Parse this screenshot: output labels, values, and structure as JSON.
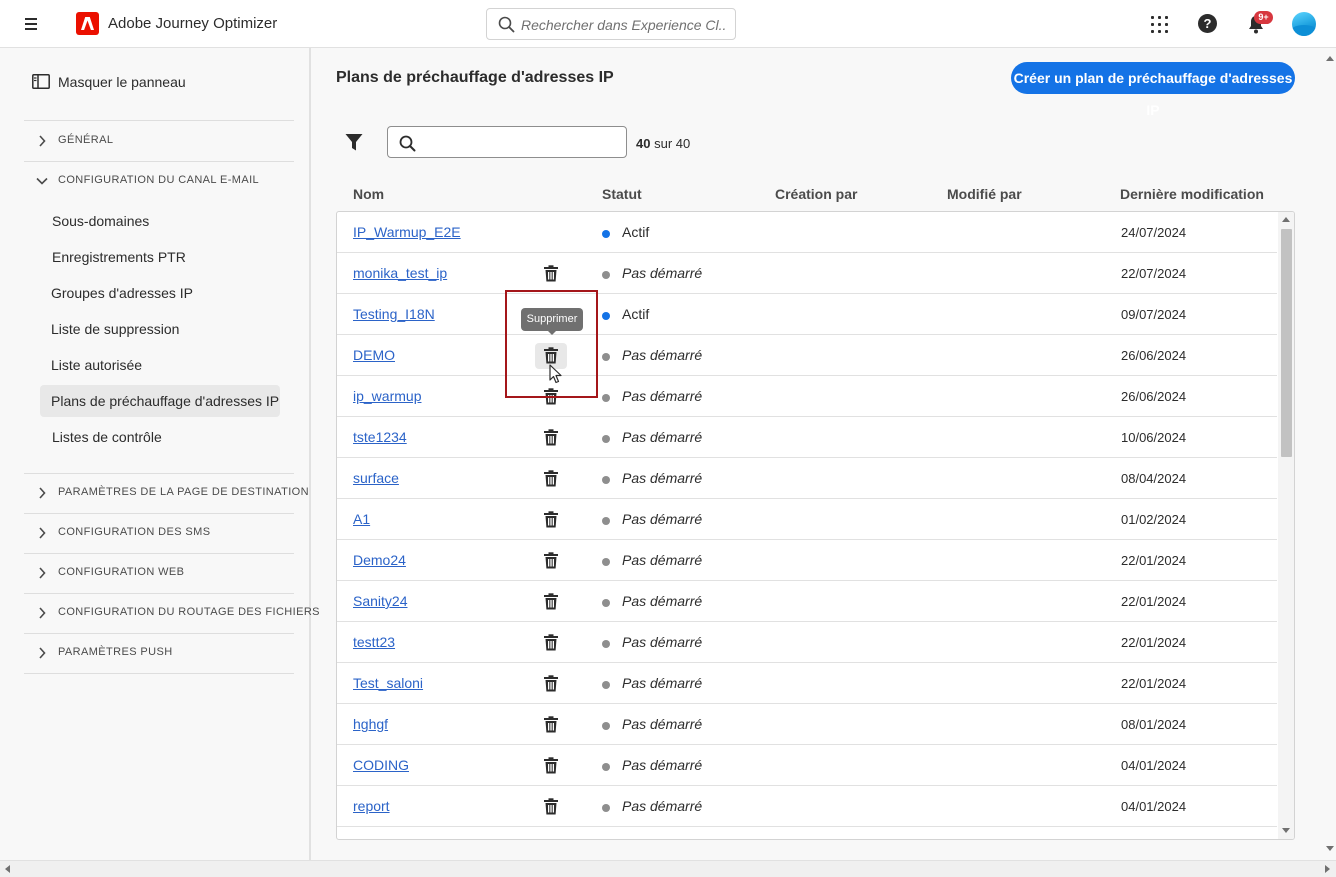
{
  "topbar": {
    "app_title": "Adobe Journey Optimizer",
    "search_placeholder": "Rechercher dans Experience Cl...",
    "notification_badge": "9+",
    "icons": [
      "menu-icon",
      "adobe-logo-icon",
      "search-icon",
      "apps-grid-icon",
      "help-icon",
      "bell-icon",
      "avatar"
    ]
  },
  "sidebar": {
    "hide_panel_label": "Masquer le panneau",
    "sections": [
      {
        "label": "GÉNÉRAL",
        "expanded": false
      },
      {
        "label": "CONFIGURATION DU CANAL E-MAIL",
        "expanded": true
      },
      {
        "label": "PARAMÈTRES DE LA PAGE DE DESTINATION",
        "expanded": false
      },
      {
        "label": "CONFIGURATION DES SMS",
        "expanded": false
      },
      {
        "label": "CONFIGURATION WEB",
        "expanded": false
      },
      {
        "label": "CONFIGURATION DU ROUTAGE DES FICHIERS",
        "expanded": false
      },
      {
        "label": "PARAMÈTRES PUSH",
        "expanded": false
      }
    ],
    "email_items": [
      {
        "label": "Sous-domaines",
        "active": false
      },
      {
        "label": "Enregistrements PTR",
        "active": false
      },
      {
        "label": "Groupes d'adresses IP",
        "active": false
      },
      {
        "label": "Liste de suppression",
        "active": false
      },
      {
        "label": "Liste autorisée",
        "active": false
      },
      {
        "label": "Plans de préchauffage d'adresses IP",
        "active": true
      },
      {
        "label": "Listes de contrôle",
        "active": false
      }
    ]
  },
  "main": {
    "title": "Plans de préchauffage d'adresses IP",
    "create_button": "Créer un plan de préchauffage d'adresses IP",
    "search_value": "",
    "count_shown": "40",
    "count_total": "sur 40",
    "columns": [
      "Nom",
      "Statut",
      "Création par",
      "Modifié par",
      "Dernière modification"
    ],
    "tooltip": "Supprimer",
    "status_colors": {
      "active": "#1473e6",
      "not_started": "#8e8e8e"
    },
    "rows": [
      {
        "name": "IP_Warmup_E2E",
        "status": "Actif",
        "state": "active",
        "created_by": "",
        "modified_by": "",
        "date": "24/07/2024",
        "delete": false
      },
      {
        "name": "monika_test_ip",
        "status": "Pas démarré",
        "state": "not_started",
        "created_by": "",
        "modified_by": "",
        "date": "22/07/2024",
        "delete": true
      },
      {
        "name": "Testing_I18N",
        "status": "Actif",
        "state": "active",
        "created_by": "",
        "modified_by": "",
        "date": "09/07/2024",
        "delete": false
      },
      {
        "name": "DEMO",
        "status": "Pas démarré",
        "state": "not_started",
        "created_by": "",
        "modified_by": "",
        "date": "26/06/2024",
        "delete": true,
        "hovered": true
      },
      {
        "name": "ip_warmup",
        "status": "Pas démarré",
        "state": "not_started",
        "created_by": "",
        "modified_by": "",
        "date": "26/06/2024",
        "delete": true
      },
      {
        "name": "tste1234",
        "status": "Pas démarré",
        "state": "not_started",
        "created_by": "",
        "modified_by": "",
        "date": "10/06/2024",
        "delete": true
      },
      {
        "name": "surface",
        "status": "Pas démarré",
        "state": "not_started",
        "created_by": "",
        "modified_by": "",
        "date": "08/04/2024",
        "delete": true
      },
      {
        "name": "A1",
        "status": "Pas démarré",
        "state": "not_started",
        "created_by": "",
        "modified_by": "",
        "date": "01/02/2024",
        "delete": true
      },
      {
        "name": "Demo24",
        "status": "Pas démarré",
        "state": "not_started",
        "created_by": "",
        "modified_by": "",
        "date": "22/01/2024",
        "delete": true
      },
      {
        "name": "Sanity24",
        "status": "Pas démarré",
        "state": "not_started",
        "created_by": "",
        "modified_by": "",
        "date": "22/01/2024",
        "delete": true
      },
      {
        "name": "testt23",
        "status": "Pas démarré",
        "state": "not_started",
        "created_by": "",
        "modified_by": "",
        "date": "22/01/2024",
        "delete": true
      },
      {
        "name": "Test_saloni",
        "status": "Pas démarré",
        "state": "not_started",
        "created_by": "",
        "modified_by": "",
        "date": "22/01/2024",
        "delete": true
      },
      {
        "name": "hghgf",
        "status": "Pas démarré",
        "state": "not_started",
        "created_by": "",
        "modified_by": "",
        "date": "08/01/2024",
        "delete": true
      },
      {
        "name": "CODING",
        "status": "Pas démarré",
        "state": "not_started",
        "created_by": "",
        "modified_by": "",
        "date": "04/01/2024",
        "delete": true
      },
      {
        "name": "report",
        "status": "Pas démarré",
        "state": "not_started",
        "created_by": "",
        "modified_by": "",
        "date": "04/01/2024",
        "delete": true
      }
    ]
  }
}
